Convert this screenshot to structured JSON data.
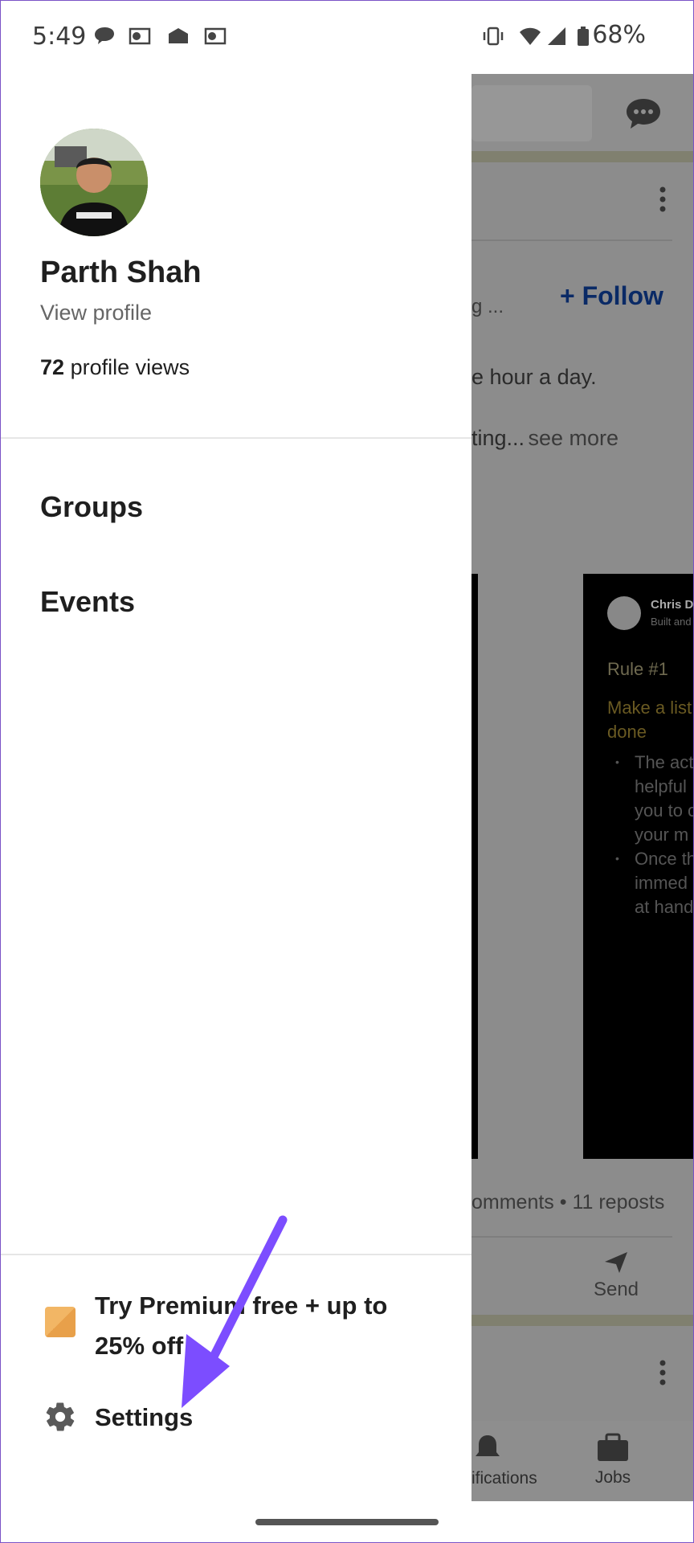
{
  "status_bar": {
    "time": "5:49",
    "battery": "68%",
    "left_icons": [
      "chat-bubble-icon",
      "outlook-icon",
      "email-icon",
      "outlook-icon"
    ],
    "right_icons": [
      "vibrate-icon",
      "wifi-icon",
      "signal-icon",
      "battery-icon"
    ]
  },
  "drawer": {
    "profile": {
      "name": "Parth Shah",
      "view_profile": "View profile",
      "views_count": "72",
      "views_label": "profile views"
    },
    "menu": [
      {
        "label": "Groups"
      },
      {
        "label": "Events"
      }
    ],
    "premium": {
      "label": "Try Premium free + up to 25% off"
    },
    "settings": {
      "label": "Settings"
    }
  },
  "background_feed": {
    "follow_label": "Follow",
    "truncated_line": "g ...",
    "post_line1": "e hour a day.",
    "post_line2": "ting...",
    "see_more": "see more",
    "card": {
      "author": "Chris Do",
      "subtitle": "Built and",
      "rule": "Rule #1",
      "heading_line1": "Make a list",
      "heading_line2": "done",
      "bullets": [
        "The act",
        "helpful",
        "you to c",
        "your m",
        "Once th",
        "immed",
        "at hand"
      ]
    },
    "stats": "omments • 11 reposts",
    "send_label": "Send",
    "nav_notifications": "ifications",
    "nav_jobs": "Jobs"
  },
  "colors": {
    "accent_arrow": "#7c4dff",
    "follow_blue": "#0a66c2",
    "overlay": "#8c8c8c"
  }
}
